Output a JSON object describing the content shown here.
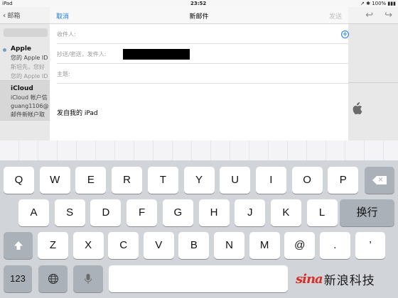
{
  "status_bar": {
    "device": "iPad",
    "time": "23:52",
    "right": "↗ ✱ 100% ▮▮▮"
  },
  "mail_bg": {
    "back_label": "邮箱",
    "messages": [
      {
        "sender": "Apple",
        "preview1": "您的 Apple ID",
        "preview2": "斯坦先，您好",
        "preview3": "您的 Apple ID"
      },
      {
        "sender": "iCloud",
        "preview1": "iCloud 帐户信",
        "preview2": "guang1106@",
        "preview3": "邮件新帐户取"
      }
    ]
  },
  "compose": {
    "cancel_label": "取消",
    "title": "新邮件",
    "send_label": "发送",
    "to_label": "收件人:",
    "cc_label": "抄送/密送，发件人:",
    "subject_label": "主题:",
    "signature": "发自我的 iPad"
  },
  "keyboard": {
    "row1": [
      "Q",
      "W",
      "E",
      "R",
      "T",
      "Y",
      "U",
      "I",
      "O",
      "P"
    ],
    "row2": [
      "A",
      "S",
      "D",
      "F",
      "G",
      "H",
      "J",
      "K",
      "L"
    ],
    "row3": [
      "Z",
      "X",
      "C",
      "V",
      "B",
      "N",
      "M",
      "@",
      "."
    ],
    "return_label": "换行",
    "numbers_label": "123",
    "comma_label": "’"
  },
  "watermark": {
    "logo": "sina",
    "text": "新浪科技"
  },
  "colors": {
    "accent": "#1a7cf5",
    "keyboard_bg": "#d1d4d9",
    "fn_key": "#abb1b9"
  },
  "icons": [
    "back-chevron-icon",
    "reply-icon",
    "forward-icon",
    "add-contact-icon",
    "apple-logo-icon",
    "backspace-icon",
    "shift-icon",
    "globe-icon",
    "mic-icon"
  ]
}
